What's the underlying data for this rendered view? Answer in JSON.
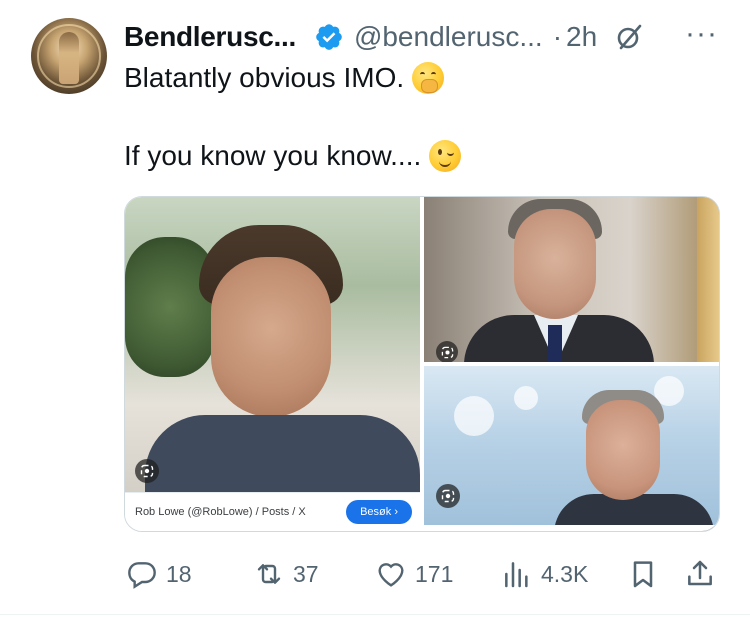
{
  "post": {
    "author_name": "Bendlerusc...",
    "handle": "@bendlerusc...",
    "separator": "·",
    "time": "2h",
    "more_label": "···",
    "text_line1": "Blatantly obvious IMO.",
    "text_line2": "If you know you know....",
    "emoji1": "hand-over-mouth-emoji",
    "emoji2": "winking-face-emoji"
  },
  "media": {
    "caption": "Rob Lowe (@RobLowe) / Posts / X",
    "visit_button": "Besøk ›"
  },
  "actions": {
    "replies": "18",
    "reposts": "37",
    "likes": "171",
    "views": "4.3K"
  },
  "colors": {
    "verified": "#1d9bf0",
    "icon_gray": "#536471",
    "text": "#0f1419",
    "visit_button": "#1a73e8"
  }
}
